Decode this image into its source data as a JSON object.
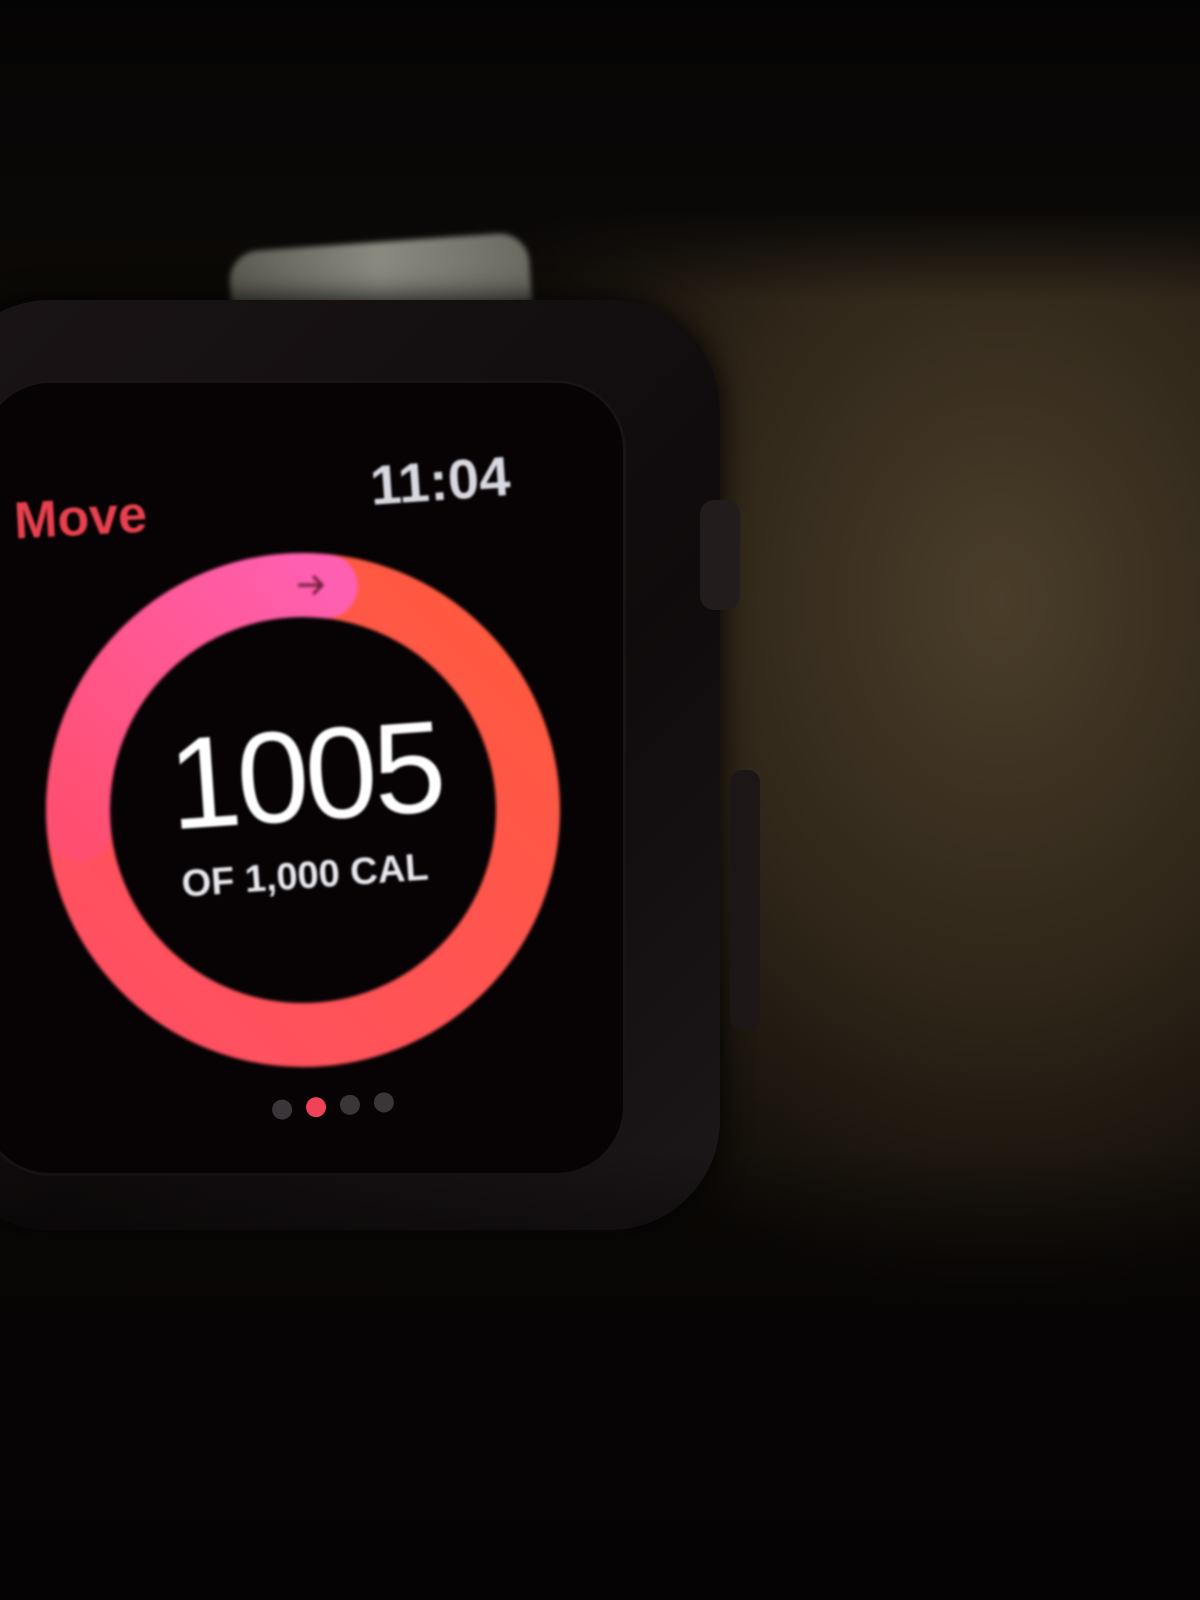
{
  "watch": {
    "app_title": "Move",
    "time": "11:04",
    "move_value": "1005",
    "move_goal_label": "OF 1,000 CAL",
    "progress_percent": 100.5,
    "page_count": 4,
    "active_page": 2,
    "colors": {
      "ring_start": "#ff5a3c",
      "ring_end": "#ff4fa0",
      "title": "#e8404e"
    }
  }
}
